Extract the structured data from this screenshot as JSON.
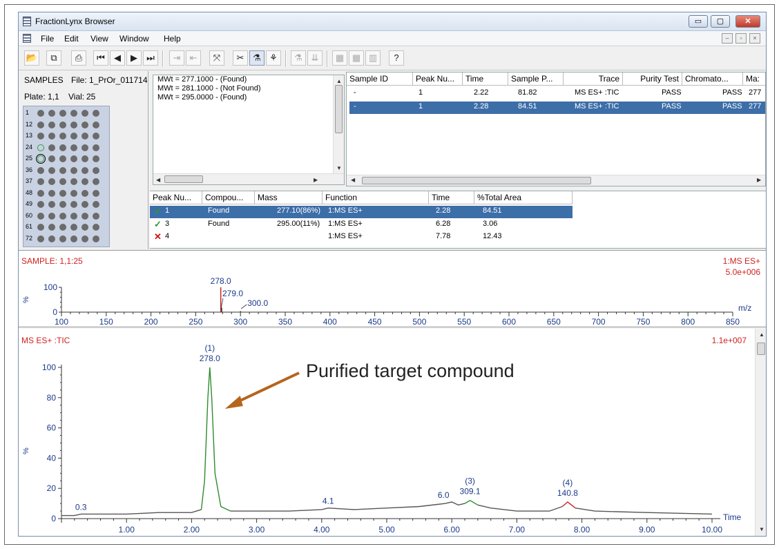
{
  "window": {
    "title": "FractionLynx Browser",
    "controls": [
      "▭",
      "▢",
      "✕"
    ]
  },
  "menu": [
    "File",
    "Edit",
    "View",
    "Window",
    "Help"
  ],
  "mdi_controls": [
    "–",
    "▫",
    "×"
  ],
  "toolbar_icons": [
    "open-folder-icon",
    "copy-icon",
    "print-icon",
    "first-icon",
    "prev-icon",
    "next-icon",
    "last-icon",
    "export-icon",
    "import-icon",
    "fit-icon",
    "tools-icon",
    "filter-icon",
    "tree-icon",
    "filter-disabled-icon",
    "down-disabled-icon",
    "grid1-icon",
    "grid2-icon",
    "grid3-icon",
    "help-icon"
  ],
  "samples": {
    "label": "SAMPLES",
    "file_label": "File:",
    "file_value": "1_PrOr_011714",
    "plate_label": "Plate:",
    "plate_value": "1,1",
    "vial_label": "Vial:",
    "vial_value": "25",
    "rows": [
      "1",
      "12",
      "13",
      "24",
      "25",
      "36",
      "37",
      "48",
      "49",
      "60",
      "61",
      "72"
    ]
  },
  "mw_list": [
    "MWt = 277.1000 - (Found)",
    "MWt = 281.1000 - (Not Found)",
    "MWt = 295.0000 - (Found)"
  ],
  "sample_table": {
    "headers": [
      "Sample ID",
      "Peak Nu...",
      "Time",
      "Sample P...",
      "Trace",
      "Purity Test",
      "Chromato...",
      "Ma:"
    ],
    "rows": [
      [
        "-",
        "1",
        "2.22",
        "81.82",
        "MS ES+ :TIC",
        "PASS",
        "PASS",
        "277"
      ],
      [
        "-",
        "1",
        "2.28",
        "84.51",
        "MS ES+ :TIC",
        "PASS",
        "PASS",
        "277"
      ]
    ]
  },
  "peak_table": {
    "headers": [
      "Peak Nu...",
      "Compou...",
      "Mass",
      "Function",
      "Time",
      "%Total Area"
    ],
    "rows": [
      {
        "status": "found",
        "peak": "1",
        "compound": "Found",
        "mass": "277.10(86%)",
        "function": "1:MS ES+",
        "time": "2.28",
        "area": "84.51"
      },
      {
        "status": "found",
        "peak": "3",
        "compound": "Found",
        "mass": "295.00(11%)",
        "function": "1:MS ES+",
        "time": "6.28",
        "area": "3.06"
      },
      {
        "status": "missing",
        "peak": "4",
        "compound": "",
        "mass": "",
        "function": "1:MS ES+",
        "time": "7.78",
        "area": "12.43"
      }
    ]
  },
  "spectrum": {
    "sample_label": "SAMPLE: 1,1:25",
    "trace_label": "1:MS ES+",
    "intensity": "5.0e+006",
    "y_unit": "%",
    "x_unit": "m/z"
  },
  "chromatogram": {
    "trace_label": "MS ES+ :TIC",
    "intensity": "1.1e+007",
    "y_unit": "%",
    "x_unit": "Time",
    "annotation": "Purified target compound"
  },
  "chart_data": [
    {
      "type": "bar",
      "x": [
        278.0,
        279.0,
        300.0
      ],
      "values": [
        100,
        18,
        4
      ],
      "peak_labels": [
        "278.0",
        "279.0",
        "300.0"
      ],
      "xlim": [
        100,
        850
      ],
      "ylim": [
        0,
        100
      ],
      "x_ticks": [
        "100",
        "150",
        "200",
        "250",
        "300",
        "350",
        "400",
        "450",
        "500",
        "550",
        "600",
        "650",
        "700",
        "750",
        "800",
        "850"
      ],
      "y_ticks": [
        "0",
        "100"
      ],
      "color": "#d02020"
    },
    {
      "type": "line",
      "x": [
        0.0,
        0.2,
        0.3,
        0.5,
        1.0,
        1.5,
        2.0,
        2.15,
        2.2,
        2.25,
        2.28,
        2.31,
        2.36,
        2.45,
        2.6,
        3.0,
        3.5,
        4.0,
        4.1,
        4.5,
        5.0,
        5.5,
        5.9,
        6.0,
        6.1,
        6.2,
        6.28,
        6.4,
        6.6,
        7.0,
        7.5,
        7.7,
        7.78,
        7.9,
        8.2,
        9.0,
        10.0
      ],
      "values": [
        2,
        2,
        3,
        3,
        3,
        4,
        4,
        6,
        25,
        80,
        100,
        80,
        30,
        8,
        5,
        5,
        5,
        6,
        7,
        6,
        7,
        8,
        10,
        11,
        9,
        10,
        12,
        9,
        7,
        5,
        5,
        8,
        11,
        7,
        5,
        4,
        3
      ],
      "peak_labels": [
        {
          "x": 0.3,
          "text": "0.3"
        },
        {
          "x": 2.28,
          "text": "(1)",
          "text2": "278.0"
        },
        {
          "x": 4.1,
          "text": "4.1"
        },
        {
          "x": 6.0,
          "text": "6.0"
        },
        {
          "x": 6.28,
          "text": "(3)",
          "text2": "309.1"
        },
        {
          "x": 7.78,
          "text": "(4)",
          "text2": "140.8"
        }
      ],
      "xlim": [
        0.0,
        10.0
      ],
      "ylim": [
        0,
        100
      ],
      "x_ticks": [
        "1.00",
        "2.00",
        "3.00",
        "4.00",
        "5.00",
        "6.00",
        "7.00",
        "8.00",
        "9.00",
        "10.00"
      ],
      "y_ticks": [
        "0",
        "20",
        "40",
        "60",
        "80",
        "100"
      ],
      "colors": {
        "main": "#2e8b2e",
        "baseline": "#555555",
        "peak4": "#d02020"
      }
    }
  ]
}
